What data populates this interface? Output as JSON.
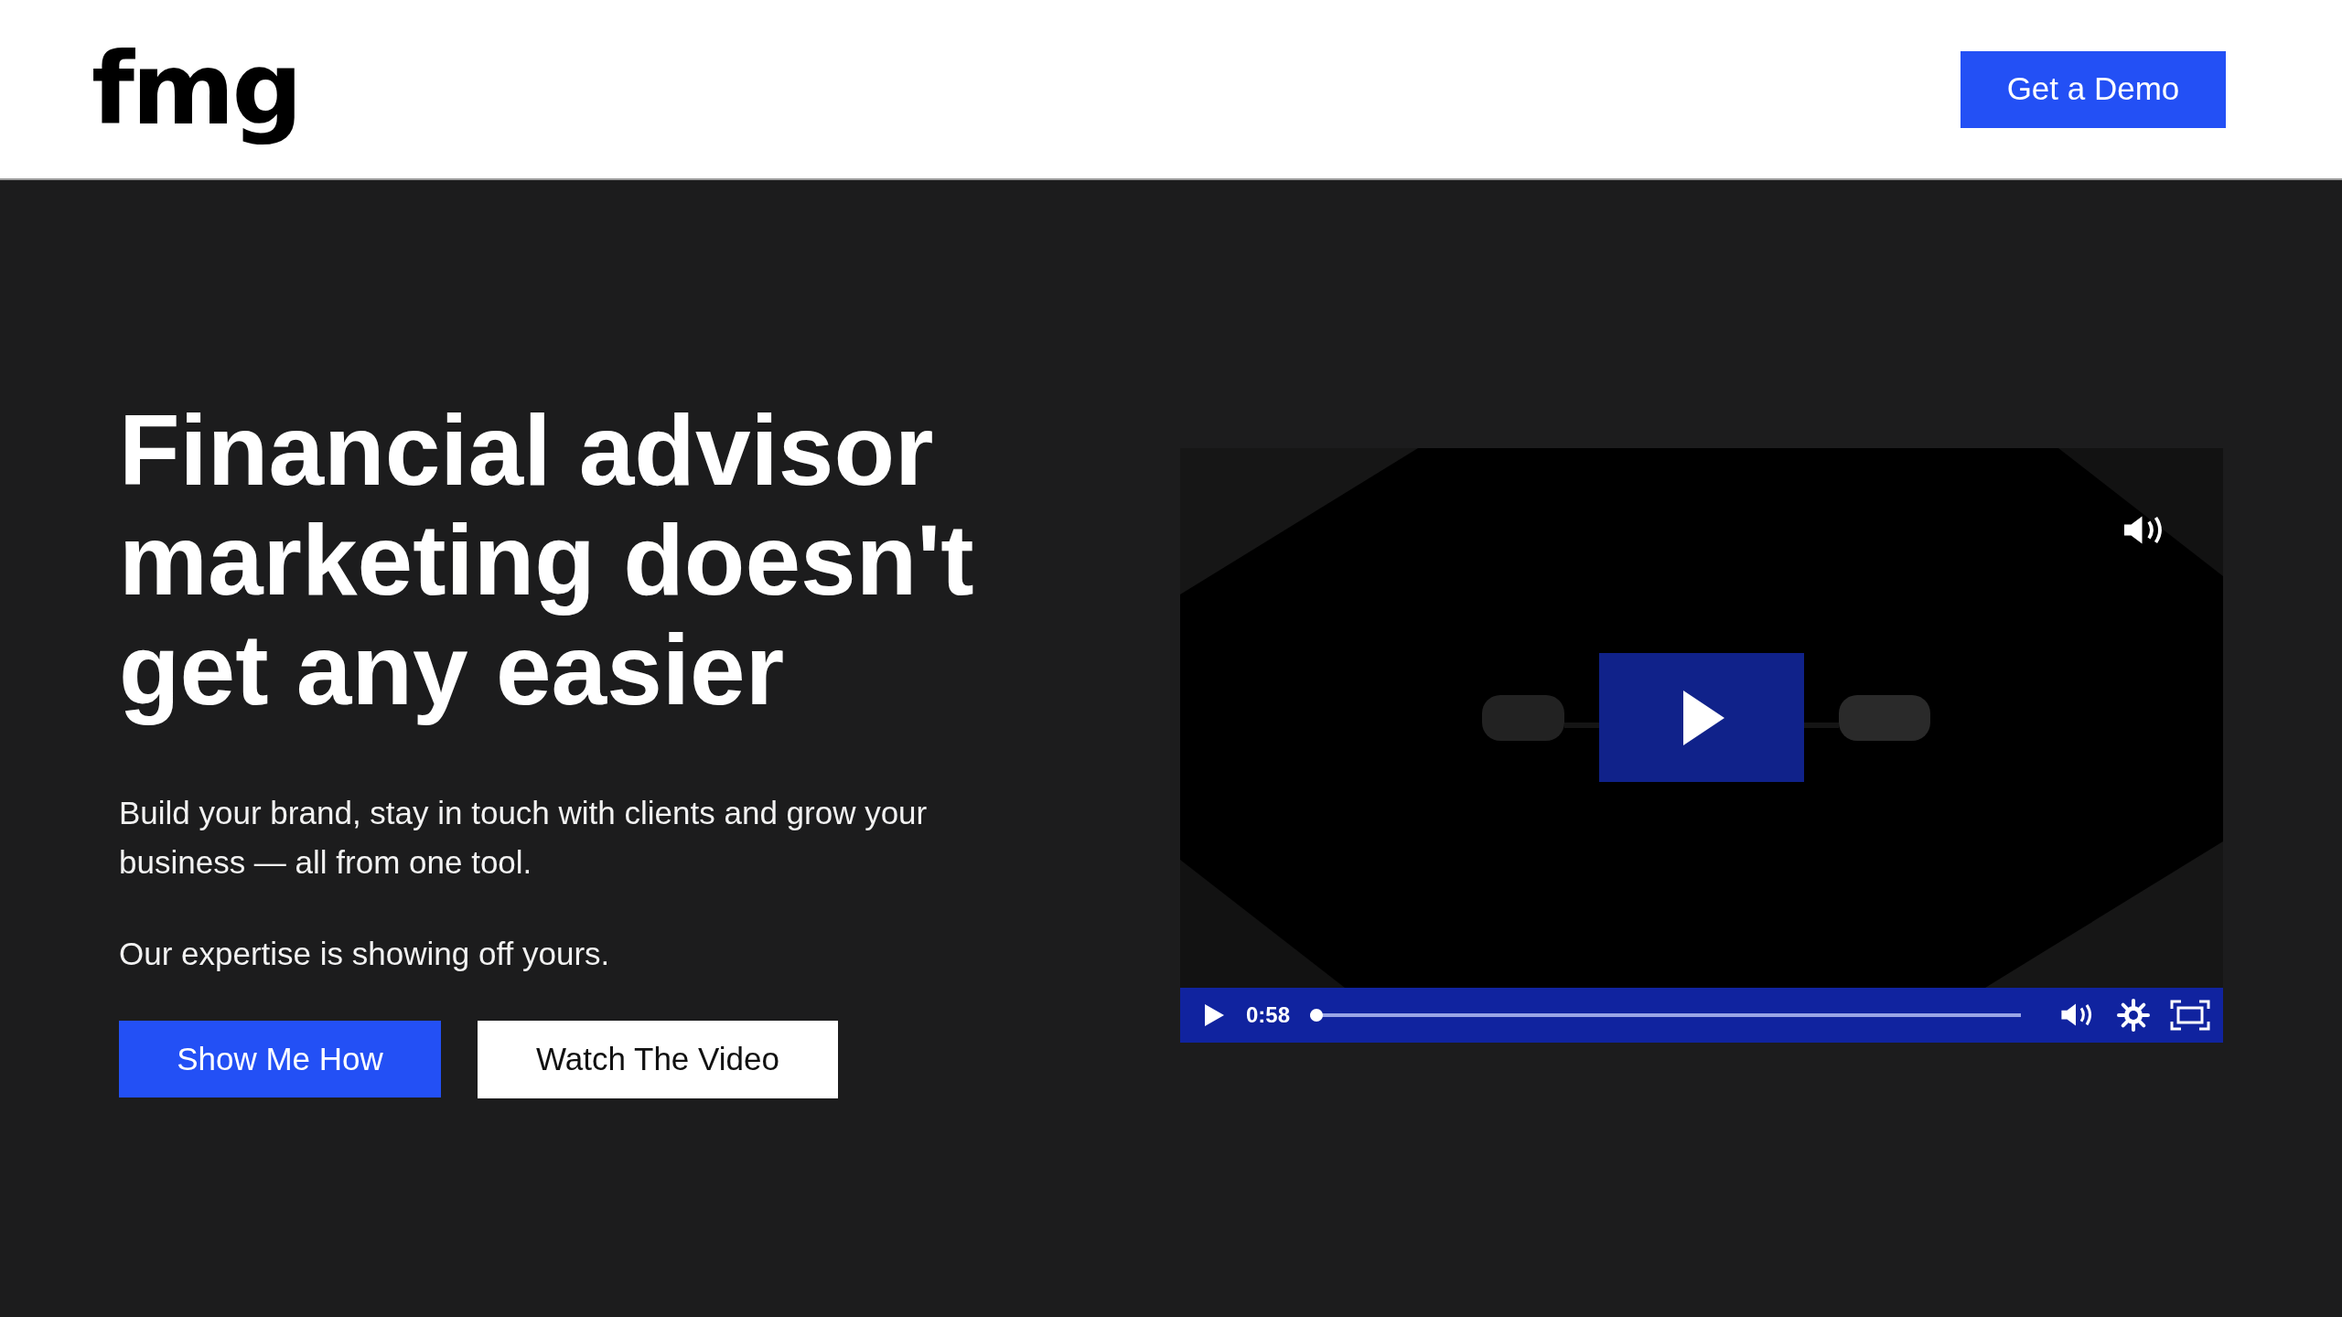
{
  "header": {
    "logo": "fmg",
    "cta": "Get a Demo"
  },
  "hero": {
    "heading": "Financial advisor marketing doesn't get any easier",
    "paragraphs": [
      "Build your brand, stay in touch with clients and grow your business — all from one tool.",
      "Our expertise is showing off yours."
    ],
    "buttons": [
      {
        "label": "Show Me How",
        "kind": "primary"
      },
      {
        "label": "Watch The Video",
        "kind": "light"
      }
    ]
  },
  "video": {
    "muted": false,
    "controls": {
      "time": "0:58",
      "progress": {
        "level": 0
      }
    }
  }
}
